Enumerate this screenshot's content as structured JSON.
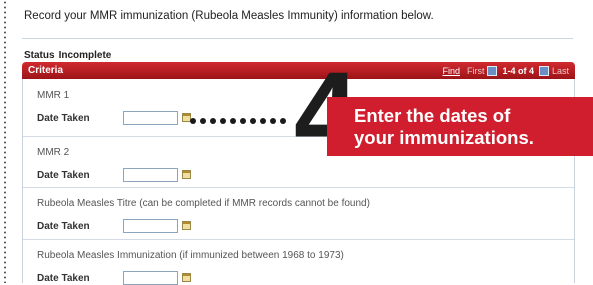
{
  "intro": "Record your MMR immunization (Rubeola Measles Immunity) information below.",
  "status": {
    "label": "Status",
    "value": "Incomplete"
  },
  "criteria": {
    "title": "Criteria",
    "pager": {
      "find": "Find",
      "first": "First",
      "count": "1-4 of 4",
      "last": "Last"
    }
  },
  "rows": [
    {
      "label": "MMR 1",
      "date_label": "Date Taken",
      "date_value": ""
    },
    {
      "label": "MMR 2",
      "date_label": "Date Taken",
      "date_value": ""
    },
    {
      "label": "Rubeola Measles Titre (can be completed if MMR records cannot be found)",
      "date_label": "Date Taken",
      "date_value": ""
    },
    {
      "label": "Rubeola Measles Immunization (if immunized between 1968 to 1973)",
      "date_label": "Date Taken",
      "date_value": ""
    }
  ],
  "callout": {
    "step_number": "4",
    "line1": "Enter the dates of",
    "line2": "your immunizations."
  },
  "colors": {
    "header_red": "#b81d22",
    "callout_red": "#d01e2e",
    "input_border": "#8da4bf"
  },
  "icons": [
    "calendar-icon",
    "first-page-icon",
    "last-page-icon"
  ]
}
